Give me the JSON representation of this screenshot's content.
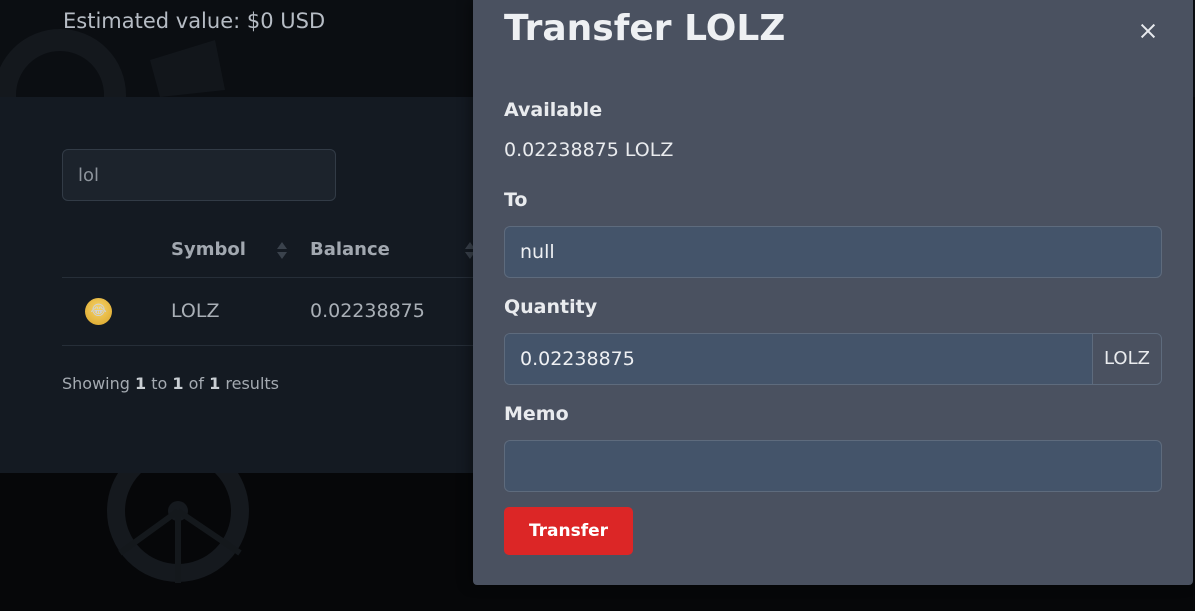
{
  "background": {
    "estimated_value": "Estimated value: $0 USD",
    "search": {
      "value": "lol"
    },
    "table": {
      "headers": {
        "symbol": "Symbol",
        "balance": "Balance"
      },
      "rows": [
        {
          "icon": "laughing-crying-emoji-icon",
          "symbol": "LOLZ",
          "balance": "0.02238875"
        }
      ]
    },
    "pagination": {
      "prefix": "Showing",
      "from": "1",
      "to_word": "to",
      "to": "1",
      "of_word": "of",
      "total": "1",
      "suffix": "results"
    }
  },
  "modal": {
    "title": "Transfer LOLZ",
    "available_label": "Available",
    "available_value": "0.02238875 LOLZ",
    "to_label": "To",
    "to_value": "null",
    "quantity_label": "Quantity",
    "quantity_value": "0.02238875",
    "quantity_unit": "LOLZ",
    "memo_label": "Memo",
    "memo_value": "",
    "transfer_button": "Transfer"
  },
  "colors": {
    "accent": "#dc2626",
    "modal_bg": "#4a5160",
    "input_bg": "#44546a"
  }
}
